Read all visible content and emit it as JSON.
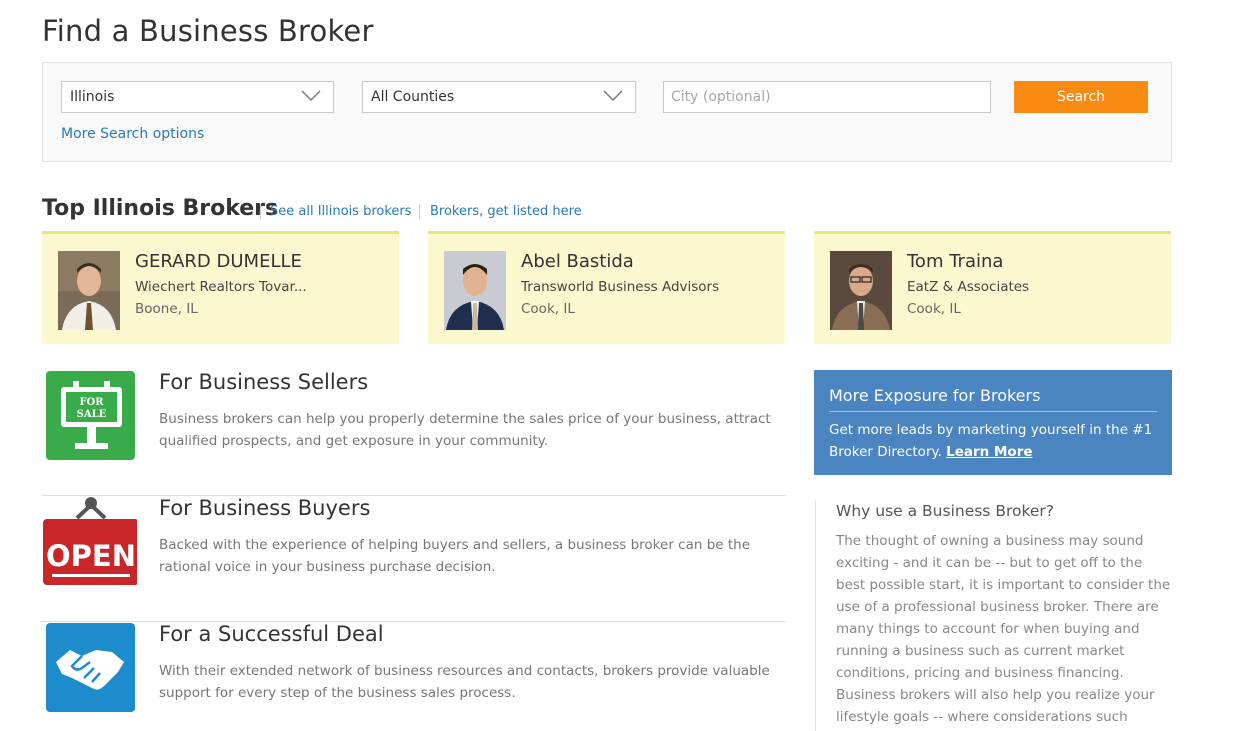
{
  "page_title": "Find a Business Broker",
  "search": {
    "state_value": "Illinois",
    "county_value": "All Counties",
    "city_placeholder": "City (optional)",
    "search_label": "Search",
    "more_options": "More Search options"
  },
  "top_brokers": {
    "title": "Top Illinois Brokers",
    "see_all": "See all Illinois brokers",
    "get_listed": "Brokers, get listed here",
    "brokers": [
      {
        "name": "GERARD DUMELLE",
        "company": "Wiechert Realtors Tovar...",
        "location": "Boone, IL"
      },
      {
        "name": "Abel Bastida",
        "company": "Transworld Business Advisors",
        "location": "Cook, IL"
      },
      {
        "name": "Tom Traina",
        "company": "EatZ & Associates",
        "location": "Cook, IL"
      }
    ]
  },
  "features": [
    {
      "icon": "for-sale-sign-icon",
      "title": "For Business Sellers",
      "text": "Business brokers can help you properly determine the sales price of your business, attract qualified prospects, and get exposure in your community."
    },
    {
      "icon": "open-sign-icon",
      "title": "For Business Buyers",
      "text": "Backed with the experience of helping buyers and sellers, a business broker can be the rational voice in your business purchase decision."
    },
    {
      "icon": "handshake-icon",
      "title": "For a Successful Deal",
      "text": "With their extended network of business resources and contacts, brokers provide valuable support for every step of the business sales process."
    }
  ],
  "exposure": {
    "title": "More Exposure for Brokers",
    "text": "Get more leads by marketing yourself in the #1 Broker Directory.",
    "link": "Learn More"
  },
  "why": {
    "title": "Why use a Business Broker?",
    "text": "The thought of owning a business may sound exciting - and it can be -- but to get off to the best possible start, it is important to consider the use of a professional business broker. There are many things to account for when buying and running a business such as current market conditions, pricing and business financing. Business brokers will also help you realize your lifestyle goals -- where considerations such"
  },
  "colors": {
    "accent_orange": "#f98a13",
    "link_blue": "#2a7ab5",
    "card_yellow": "#fbf8cf",
    "exposure_blue": "#4a85c2",
    "icon_green": "#3aab4a",
    "icon_red": "#c9262a",
    "icon_blue": "#1d8ccc"
  }
}
